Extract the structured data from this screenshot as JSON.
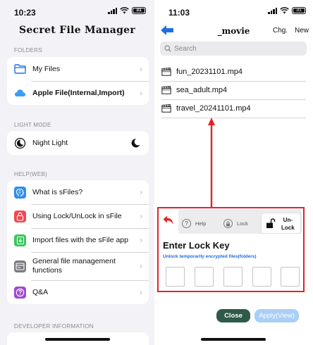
{
  "left": {
    "status_time": "10:23",
    "battery": "31",
    "app_title": "Secret File Manager",
    "sections": {
      "folders": "FOLDERS",
      "light_mode": "LIGHT MODE",
      "help": "HELP(WEB)",
      "developer": "DEVELOPER INFORMATION"
    },
    "folders": [
      {
        "label": "My Files",
        "icon": "folder-icon",
        "color": "#1f6fe5"
      },
      {
        "label": "Apple File(Internal,Import)",
        "icon": "cloud-icon",
        "color": "#3b9ef5"
      }
    ],
    "light_mode_row": {
      "label": "Night Light",
      "icon": "moon-icon",
      "toggle_icon": "crescent-moon-icon"
    },
    "help_items": [
      {
        "label": "What is sFiles?",
        "icon": "brain-icon",
        "color": "#2e8df0"
      },
      {
        "label": "Using Lock/UnLock in sFile",
        "icon": "padlock-icon",
        "color": "#f0484f"
      },
      {
        "label": "Import files with the sFile app",
        "icon": "download-icon",
        "color": "#38c759"
      },
      {
        "label": "General file management functions",
        "icon": "storage-icon",
        "color": "#7b7b80"
      },
      {
        "label": "Q&A",
        "icon": "question-icon",
        "color": "#a049d4"
      }
    ]
  },
  "right": {
    "status_time": "11:03",
    "battery": "31",
    "nav_title": "_movie",
    "nav_chg": "Chg.",
    "nav_new": "New",
    "search_placeholder": "Search",
    "files": [
      {
        "name": "fun_20231101.mp4",
        "icon": "video-file-icon"
      },
      {
        "name": "sea_adult.mp4",
        "icon": "video-file-icon"
      },
      {
        "name": "travel_20241101.mp4",
        "icon": "video-file-icon"
      }
    ],
    "lock_panel": {
      "help_label": "Help",
      "lock_label": "Lock",
      "unlock_label_1": "Un-",
      "unlock_label_2": "Lock",
      "title": "Enter Lock Key",
      "subtitle": "Unlock temporarily encrypted files(folders)",
      "key_box_count": 5
    },
    "close_label": "Close",
    "apply_label": "Apply(View)",
    "colors": {
      "accent": "#1f6fe5",
      "highlight": "#e0242a",
      "close_btn": "#2f5a4a",
      "apply_btn": "#a9cff7"
    }
  }
}
